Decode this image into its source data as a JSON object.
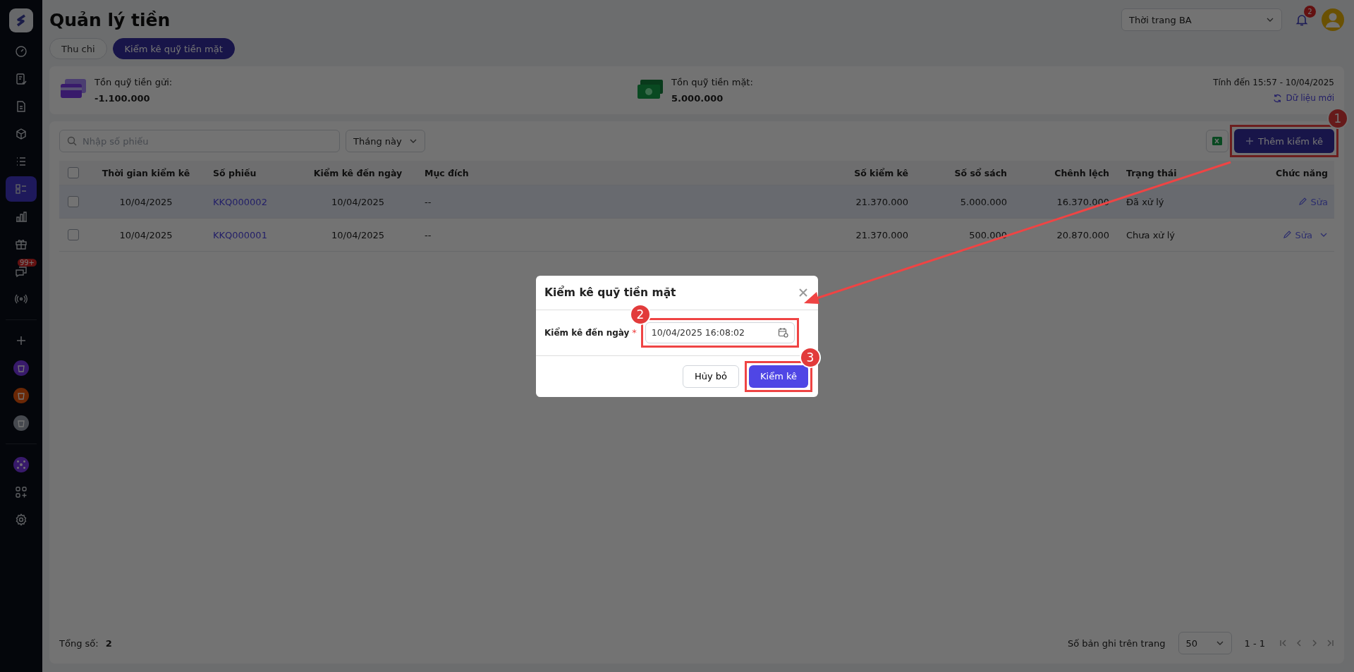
{
  "sidebar": {
    "items": [
      {
        "selected": false
      },
      {
        "selected": false
      },
      {
        "selected": false
      },
      {
        "selected": false
      },
      {
        "selected": false
      },
      {
        "selected": true
      },
      {
        "selected": false
      },
      {
        "selected": false
      },
      {
        "selected": false,
        "badge": "99+"
      },
      {
        "selected": false
      }
    ],
    "channels": [
      {
        "selected": false
      },
      {
        "selected": false
      },
      {
        "selected": false
      }
    ],
    "extras": [
      {
        "selected": false
      },
      {
        "selected": false
      },
      {
        "selected": false
      }
    ]
  },
  "header": {
    "title": "Quản lý tiền",
    "store_select": "Thời trang BA",
    "notification_count": "2"
  },
  "tabs": [
    {
      "label": "Thu chi",
      "selected": false
    },
    {
      "label": "Kiểm kê quỹ tiền mặt",
      "selected": true
    }
  ],
  "summary": {
    "deposit": {
      "label": "Tồn quỹ tiền gửi:",
      "value": "-1.100.000"
    },
    "cash": {
      "label": "Tồn quỹ tiền mặt:",
      "value": "5.000.000"
    },
    "as_of": "Tính đến 15:57 - 10/04/2025",
    "refresh": "Dữ liệu mới"
  },
  "toolbar": {
    "search": {
      "placeholder": "Nhập số phiếu"
    },
    "period": "Tháng này",
    "add_button": "Thêm kiểm kê"
  },
  "table": {
    "all_checked": false,
    "columns": [
      "Thời gian kiểm kê",
      "Số phiếu",
      "Kiểm kê đến ngày",
      "Mục đích",
      "Số kiểm kê",
      "Số sổ sách",
      "Chênh lệch",
      "Trạng thái",
      "Chức năng"
    ],
    "rows": [
      {
        "selected": true,
        "checked": false,
        "cells": [
          "10/04/2025",
          "KKQ000002",
          "10/04/2025",
          "--",
          "21.370.000",
          "5.000.000",
          "16.370.000",
          "Đã xử lý"
        ],
        "action": "Sửa",
        "has_menu": false
      },
      {
        "selected": false,
        "checked": false,
        "cells": [
          "10/04/2025",
          "KKQ000001",
          "10/04/2025",
          "--",
          "21.370.000",
          "500.000",
          "20.870.000",
          "Chưa xử lý"
        ],
        "action": "Sửa",
        "has_menu": true
      }
    ]
  },
  "footer": {
    "total_label": "Tổng số:",
    "total": "2",
    "per_page_label": "Số bản ghi trên trang",
    "per_page": "50",
    "range": "1 - 1"
  },
  "modal": {
    "title": "Kiểm kê quỹ tiền mặt",
    "field_label": "Kiểm kê đến ngày",
    "required_mark": "*",
    "value": "10/04/2025 16:08:02",
    "cancel": "Hủy bỏ",
    "confirm": "Kiểm kê"
  },
  "annotations": [
    {
      "number": "1"
    },
    {
      "number": "2"
    },
    {
      "number": "3"
    }
  ]
}
